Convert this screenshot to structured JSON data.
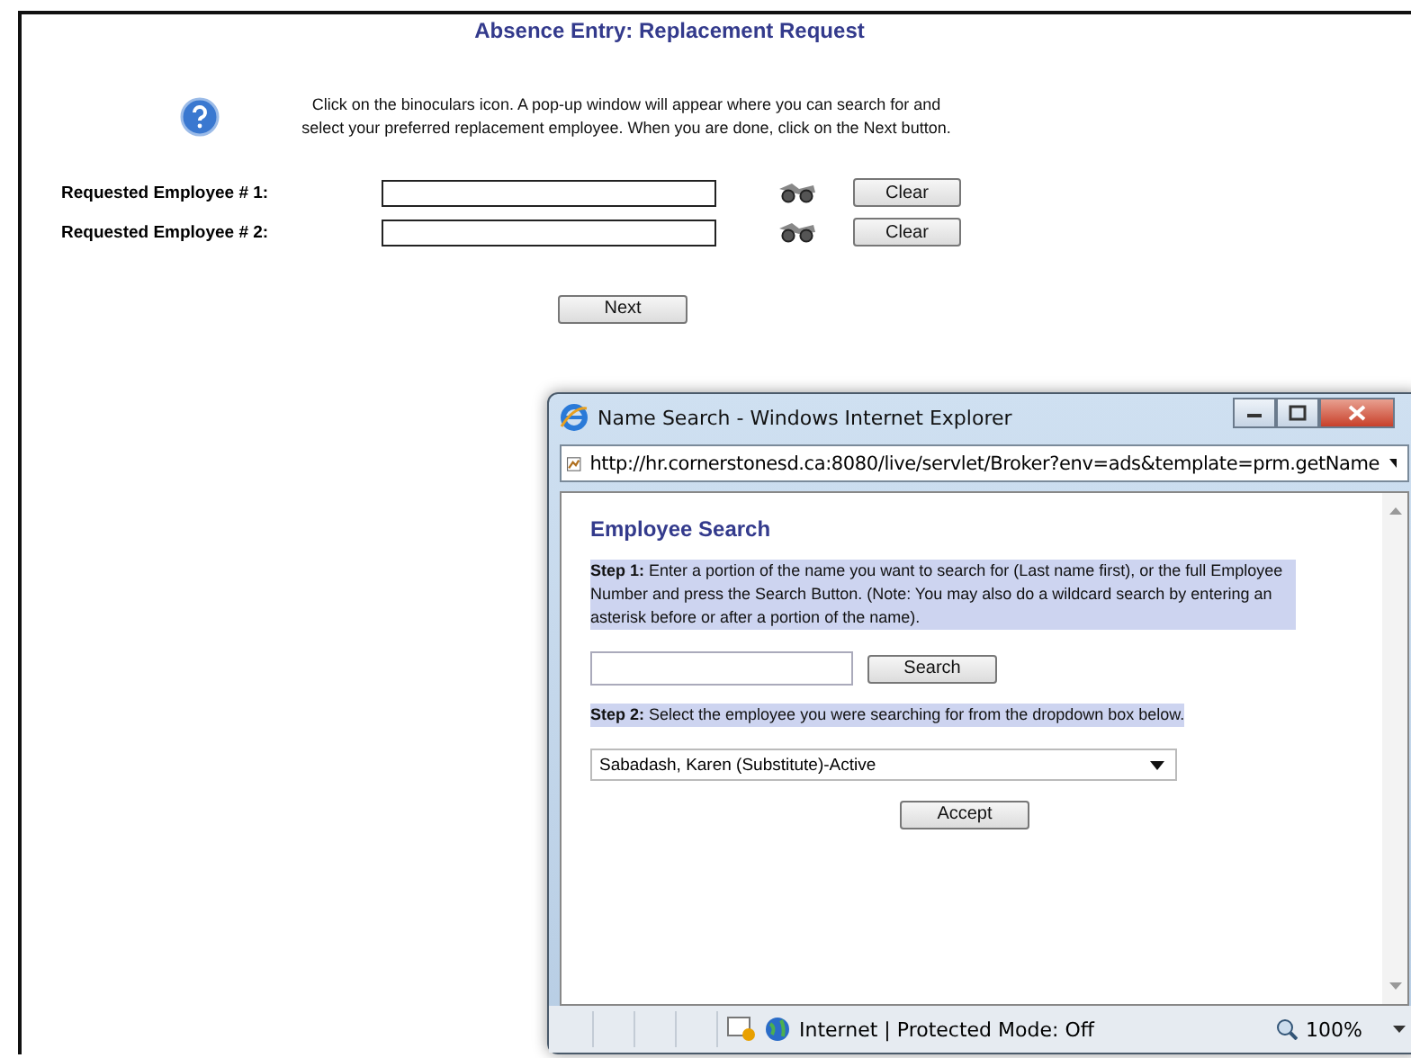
{
  "page": {
    "title": "Absence Entry: Replacement Request",
    "help_text": "Click on the binoculars icon. A pop-up window will appear where you can search for and select your preferred replacement employee. When you are done, click on the Next button.",
    "fields": [
      {
        "label": "Requested Employee # 1:",
        "button": "Clear"
      },
      {
        "label": "Requested Employee # 2:",
        "button": "Clear"
      }
    ],
    "next_button": "Next"
  },
  "popup": {
    "title": "Name Search - Windows Internet Explorer",
    "address": "http://hr.cornerstonesd.ca:8080/live/servlet/Broker?env=ads&template=prm.getName",
    "heading": "Employee Search",
    "step1": {
      "text": "**Step 1:** Enter a portion of the name you want to search for (Last name first), or the full Employee Number and press the Search Button. (Note: You may also do a wildcard search by entering an asterisk before or after a portion of the name).",
      "highlighted": true
    },
    "search_button": "Search",
    "step2": {
      "text": "**Step 2:** Select the employee you were searching for from the dropdown box below.",
      "highlighted": true
    },
    "dropdown_value": "Sabadash, Karen (Substitute)-Active",
    "accept_button": "Accept",
    "status": "Internet | Protected Mode: Off",
    "zoom": "100%"
  }
}
